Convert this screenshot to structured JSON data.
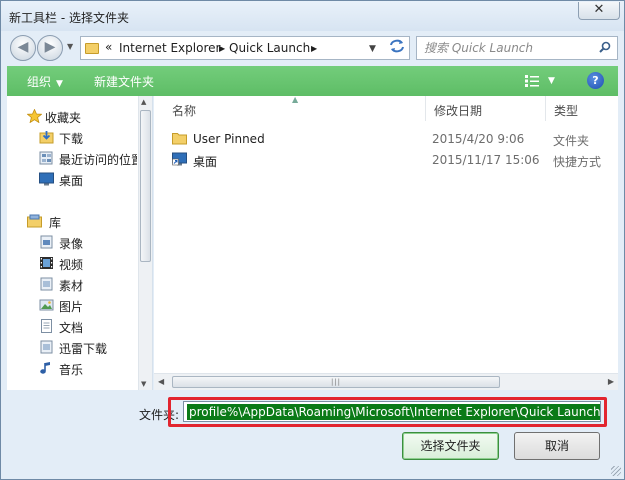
{
  "window": {
    "title": "新工具栏 - 选择文件夹",
    "close_glyph": "✕"
  },
  "nav": {
    "back_glyph": "◀",
    "forward_glyph": "▶",
    "breadcrumb_overflow": "«",
    "breadcrumb": [
      "Internet Explorer",
      "Quick Launch"
    ],
    "separator_glyph": "▶",
    "search_placeholder": "搜索 Quick Launch"
  },
  "toolbar": {
    "organize_label": "组织",
    "new_folder_label": "新建文件夹",
    "caret_glyph": "▼",
    "help_glyph": "?"
  },
  "sidebar": {
    "favorites": {
      "label": "收藏夹",
      "icon": "star-icon",
      "items": [
        {
          "label": "下载",
          "icon": "download-folder-icon"
        },
        {
          "label": "最近访问的位置",
          "icon": "recent-places-icon"
        },
        {
          "label": "桌面",
          "icon": "desktop-icon"
        }
      ]
    },
    "libraries": {
      "label": "库",
      "icon": "library-icon",
      "items": [
        {
          "label": "录像",
          "icon": "video-library-icon"
        },
        {
          "label": "视频",
          "icon": "film-icon"
        },
        {
          "label": "素材",
          "icon": "library-doc-icon"
        },
        {
          "label": "图片",
          "icon": "pictures-icon"
        },
        {
          "label": "文档",
          "icon": "documents-icon"
        },
        {
          "label": "迅雷下载",
          "icon": "library-doc-icon"
        },
        {
          "label": "音乐",
          "icon": "music-icon"
        }
      ]
    }
  },
  "file_list": {
    "columns": [
      "名称",
      "修改日期",
      "类型"
    ],
    "rows": [
      {
        "name": "User Pinned",
        "modified": "2015/4/20 9:06",
        "type": "文件夹",
        "icon": "folder-icon"
      },
      {
        "name": "桌面",
        "modified": "2015/11/17 15:06",
        "type": "快捷方式",
        "icon": "shortcut-icon"
      }
    ]
  },
  "footer": {
    "folder_label": "文件夹:",
    "folder_value": "profile%\\AppData\\Roaming\\Microsoft\\Internet Explorer\\Quick Launch",
    "select_button": "选择文件夹",
    "cancel_button": "取消"
  },
  "colors": {
    "toolbar_bg": "#66c46e",
    "selection_bg": "#0a7a17",
    "highlight_box": "#e2252f"
  }
}
